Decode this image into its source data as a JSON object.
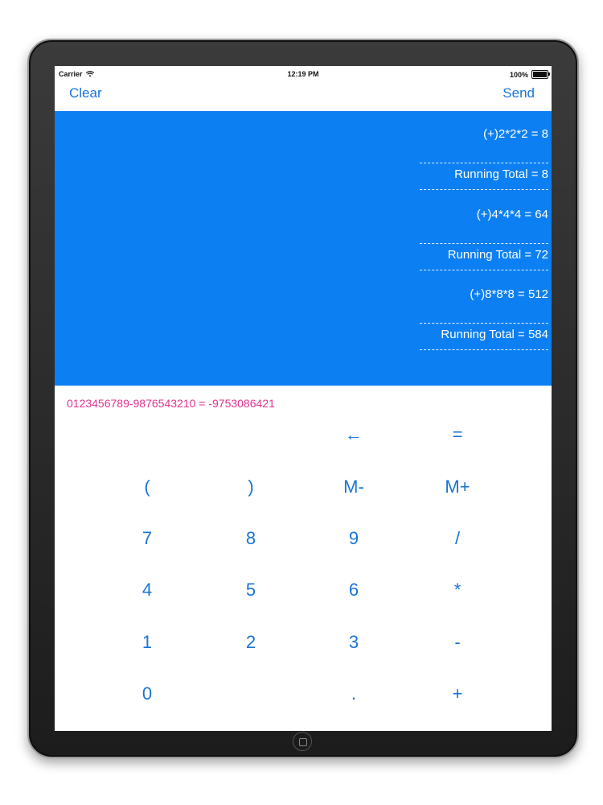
{
  "status_bar": {
    "carrier": "Carrier",
    "time": "12:19 PM",
    "battery": "100%"
  },
  "nav": {
    "clear_label": "Clear",
    "send_label": "Send"
  },
  "history": [
    {
      "type": "expression",
      "text": "(+)2*2*2 = 8"
    },
    {
      "type": "total",
      "text": "Running Total = 8"
    },
    {
      "type": "expression",
      "text": "(+)4*4*4 = 64"
    },
    {
      "type": "total",
      "text": "Running Total = 72"
    },
    {
      "type": "expression",
      "text": "(+)8*8*8 = 512"
    },
    {
      "type": "total",
      "text": "Running Total = 584"
    }
  ],
  "expression": "0123456789-9876543210 = -9753086421",
  "keys": {
    "backspace": "←",
    "equals": "=",
    "open_paren": "(",
    "close_paren": ")",
    "mem_minus": "M-",
    "mem_plus": "M+",
    "seven": "7",
    "eight": "8",
    "nine": "9",
    "divide": "/",
    "four": "4",
    "five": "5",
    "six": "6",
    "multiply": "*",
    "one": "1",
    "two": "2",
    "three": "3",
    "minus": "-",
    "zero": "0",
    "decimal": ".",
    "plus": "+"
  },
  "colors": {
    "accent": "#1a74d6",
    "history_bg": "#0c7ff2",
    "expression": "#e0338f"
  }
}
